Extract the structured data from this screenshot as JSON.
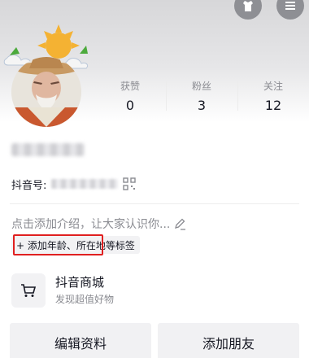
{
  "header": {
    "edit_icon": "robe-icon",
    "menu_icon": "menu-icon"
  },
  "profile": {
    "stats": [
      {
        "label": "获赞",
        "value": "0"
      },
      {
        "label": "粉丝",
        "value": "3"
      },
      {
        "label": "关注",
        "value": "12"
      }
    ],
    "id_label": "抖音号:",
    "intro_placeholder": "点击添加介绍，让大家认识你...",
    "tag_chip": "+ 添加年龄、所在地等标签"
  },
  "shop": {
    "title": "抖音商城",
    "subtitle": "发现超值好物",
    "icon": "shopping-cart-icon"
  },
  "actions": {
    "edit_profile": "编辑资料",
    "add_friend": "添加朋友"
  },
  "colors": {
    "highlight_border": "#e02020",
    "chip_background": "#f2f2f4",
    "muted_text": "#8a8b91"
  }
}
